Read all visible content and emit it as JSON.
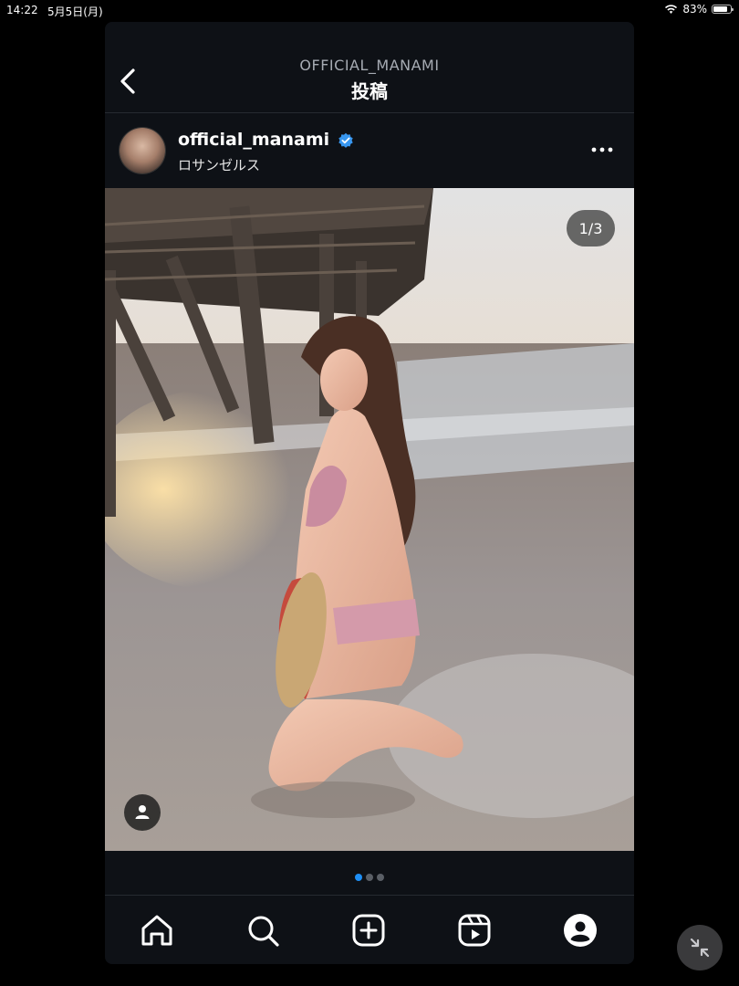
{
  "status_bar": {
    "time": "14:22",
    "date": "5月5日(月)",
    "battery": "83%",
    "battery_level": 0.83
  },
  "header": {
    "account": "OFFICIAL_MANAMI",
    "title": "投稿"
  },
  "post": {
    "username": "official_manami",
    "location": "ロサンゼルス",
    "verified": true,
    "counter": "1/3",
    "carousel": {
      "total": 3,
      "active": 0
    }
  },
  "nav": {
    "items": [
      "home-icon",
      "search-icon",
      "create-icon",
      "reels-icon",
      "profile-icon"
    ]
  },
  "colors": {
    "background": "#0e1116",
    "accent": "#1e8ff5",
    "verified": "#3897f0"
  }
}
